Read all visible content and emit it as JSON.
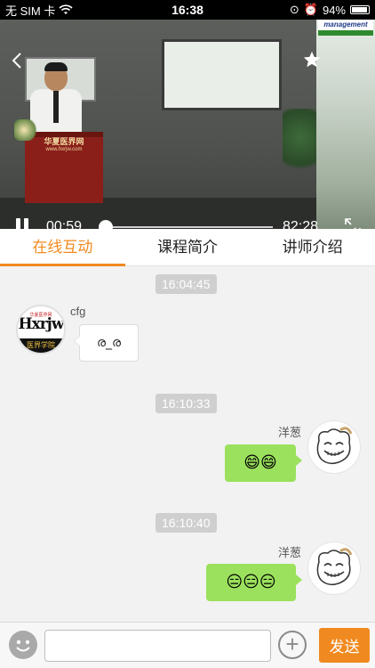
{
  "status_bar": {
    "carrier": "无 SIM 卡",
    "time": "16:38",
    "battery": "94%",
    "battery_level": 0.94
  },
  "video": {
    "podium_text": "华夏医界网",
    "podium_url": "www.hxrjw.com",
    "side_logo": "management",
    "current_time": "00:59",
    "total_time": "82:28",
    "progress": 0.012
  },
  "tabs": [
    {
      "label": "在线互动",
      "active": true
    },
    {
      "label": "课程简介",
      "active": false
    },
    {
      "label": "讲师介绍",
      "active": false
    }
  ],
  "chat": {
    "messages": [
      {
        "time": "16:04:45",
        "sender": "cfg",
        "side": "left",
        "text": "ര_ര"
      },
      {
        "time": "16:10:33",
        "sender": "洋葱",
        "side": "right",
        "text": "😄😄"
      },
      {
        "time": "16:10:40",
        "sender": "洋葱",
        "side": "right",
        "text": "😑😑😑"
      }
    ],
    "left_avatar": {
      "top": "华夏医界网",
      "main": "Hxrjw",
      "bottom": "医界学院"
    }
  },
  "input": {
    "placeholder": "",
    "send_label": "发送"
  },
  "colors": {
    "accent": "#f08a20",
    "bubble_green": "#9be15d",
    "background": "#f2f2f2"
  }
}
